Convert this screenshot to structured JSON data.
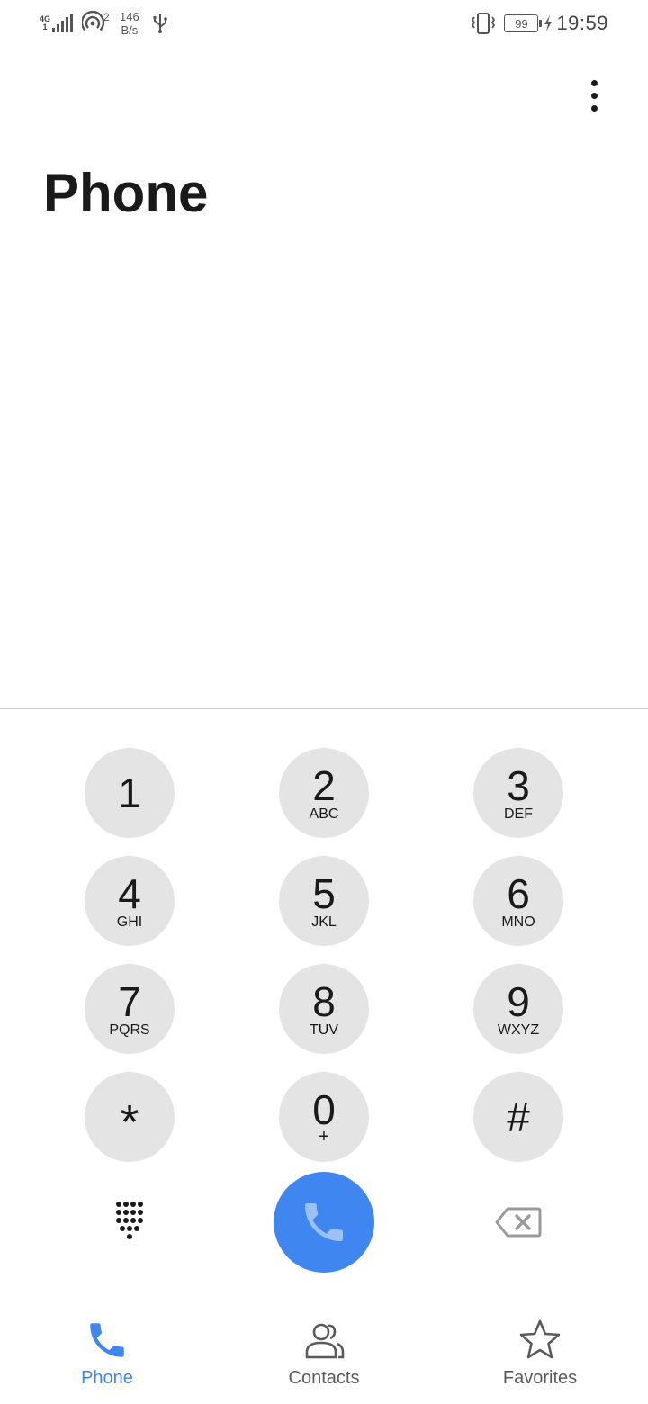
{
  "status_bar": {
    "network_type_top": "4G",
    "network_type_bottom": "1",
    "hotspot_count": "2",
    "speed_value": "146",
    "speed_unit": "B/s",
    "battery_level": "99",
    "time": "19:59",
    "icons": [
      "signal-icon",
      "hotspot-icon",
      "usb-icon",
      "vibrate-icon",
      "battery-icon",
      "charging-icon"
    ]
  },
  "header": {
    "title": "Phone",
    "menu_icon": "more-vert-icon"
  },
  "keypad": {
    "keys": [
      {
        "digit": "1",
        "letters": ""
      },
      {
        "digit": "2",
        "letters": "ABC"
      },
      {
        "digit": "3",
        "letters": "DEF"
      },
      {
        "digit": "4",
        "letters": "GHI"
      },
      {
        "digit": "5",
        "letters": "JKL"
      },
      {
        "digit": "6",
        "letters": "MNO"
      },
      {
        "digit": "7",
        "letters": "PQRS"
      },
      {
        "digit": "8",
        "letters": "TUV"
      },
      {
        "digit": "9",
        "letters": "WXYZ"
      },
      {
        "digit": "*",
        "letters": ""
      },
      {
        "digit": "0",
        "letters": "+"
      },
      {
        "digit": "#",
        "letters": ""
      }
    ],
    "toggle_icon": "dialpad-icon",
    "call_icon": "phone-icon",
    "backspace_icon": "backspace-icon",
    "call_color": "#3f86f0"
  },
  "bottom_nav": {
    "tabs": [
      {
        "label": "Phone",
        "icon": "phone-icon",
        "active": true
      },
      {
        "label": "Contacts",
        "icon": "contacts-icon",
        "active": false
      },
      {
        "label": "Favorites",
        "icon": "star-icon",
        "active": false
      }
    ],
    "active_color": "#3f86f0",
    "inactive_color": "#5a5a5a"
  }
}
